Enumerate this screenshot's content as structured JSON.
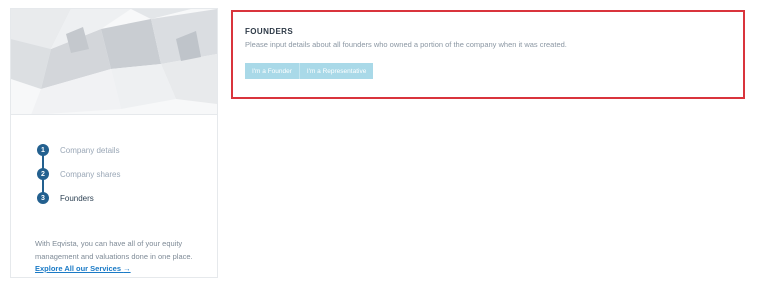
{
  "steps": [
    {
      "number": "1",
      "label": "Company details"
    },
    {
      "number": "2",
      "label": "Company shares"
    },
    {
      "number": "3",
      "label": "Founders"
    }
  ],
  "promo": {
    "text": "With Eqvista, you can have all of your equity management and valuations done in one place.",
    "link_label": "Explore All our Services",
    "link_arrow": "→"
  },
  "founders": {
    "title": "FOUNDERS",
    "description": "Please input details about all founders who owned a portion of the company when it was created.",
    "buttons": [
      "I'm a Founder",
      "I'm a Representative"
    ]
  },
  "colors": {
    "step_accent": "#23608f",
    "panel_border": "#d9343c",
    "button_fill": "#a9d9e8",
    "link": "#1a7ac6"
  }
}
